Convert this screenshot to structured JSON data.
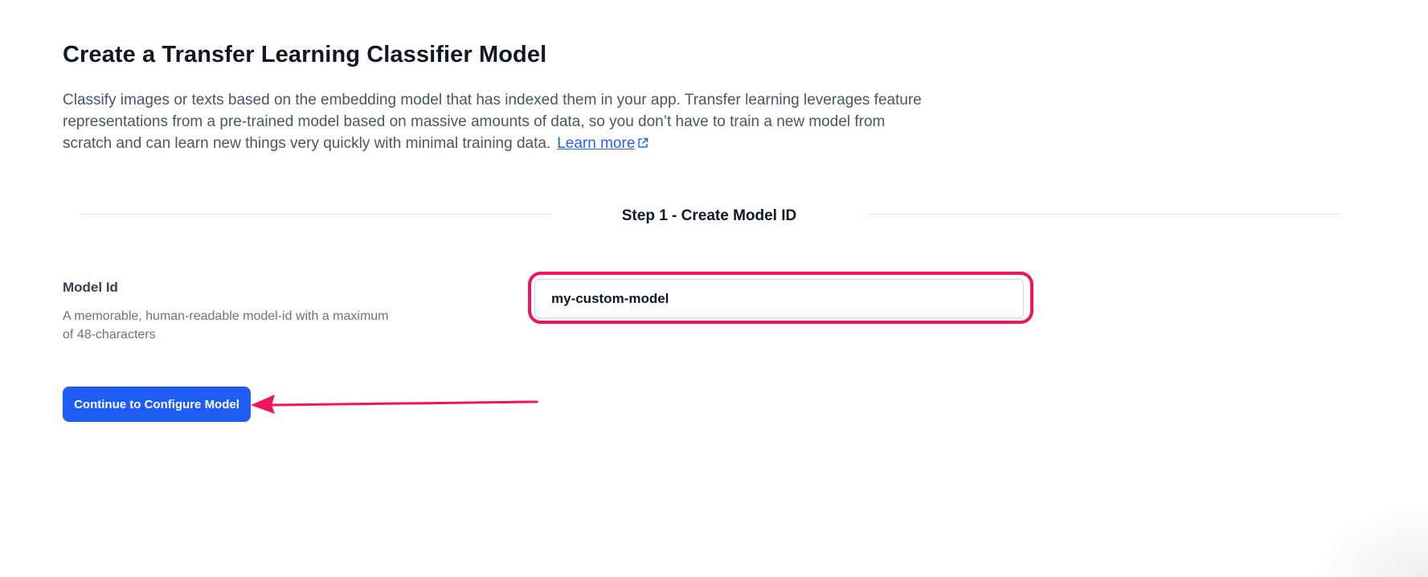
{
  "page": {
    "title": "Create a Transfer Learning Classifier Model",
    "intro": "Classify images or texts based on the embedding model that has indexed them in your app. Transfer learning leverages feature representations from a pre-trained model based on massive amounts of data, so you don’t have to train a new model from scratch and can learn new things very quickly with minimal training data.",
    "learn_more_label": "Learn more"
  },
  "step": {
    "title": "Step 1 - Create Model ID"
  },
  "model_id_field": {
    "label": "Model Id",
    "help": "A memorable, human-readable model-id with a maximum of 48-characters",
    "value": "my-custom-model"
  },
  "actions": {
    "continue_label": "Continue to Configure Model"
  },
  "colors": {
    "accent": "#1d5cf5",
    "annotation": "#f0145f",
    "link": "#2563eb"
  },
  "icons": {
    "learn_more": "external-link-icon",
    "annotation_arrow": "arrow-left-icon"
  }
}
